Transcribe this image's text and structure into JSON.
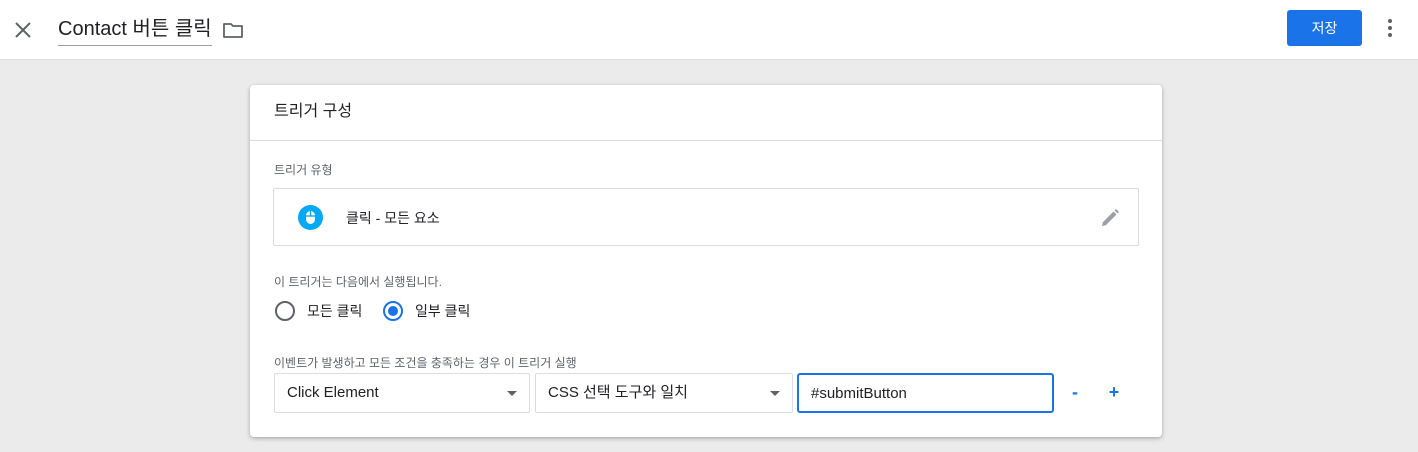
{
  "header": {
    "title": "Contact 버튼 클릭",
    "save_label": "저장"
  },
  "icons": {
    "close": "close-icon",
    "folder": "folder-icon",
    "more": "more-vert-icon",
    "trigger_type": "mouse-icon",
    "edit": "pencil-icon"
  },
  "colors": {
    "accent": "#1a73e8",
    "trigger_icon": "#03a9f4"
  },
  "card": {
    "title": "트리거 구성",
    "trigger_type_label": "트리거 유형",
    "trigger_type_value": "클릭 - 모든 요소",
    "fires_on_label": "이 트리거는 다음에서 실행됩니다.",
    "fires_on_options": [
      {
        "label": "모든 클릭",
        "selected": false
      },
      {
        "label": "일부 클릭",
        "selected": true
      }
    ],
    "condition_label": "이벤트가 발생하고 모든 조건을 충족하는 경우 이 트리거 실행",
    "condition": {
      "variable": "Click Element",
      "operator": "CSS 선택 도구와 일치",
      "value": "#submitButton"
    },
    "remove_label": "-",
    "add_label": "+"
  }
}
